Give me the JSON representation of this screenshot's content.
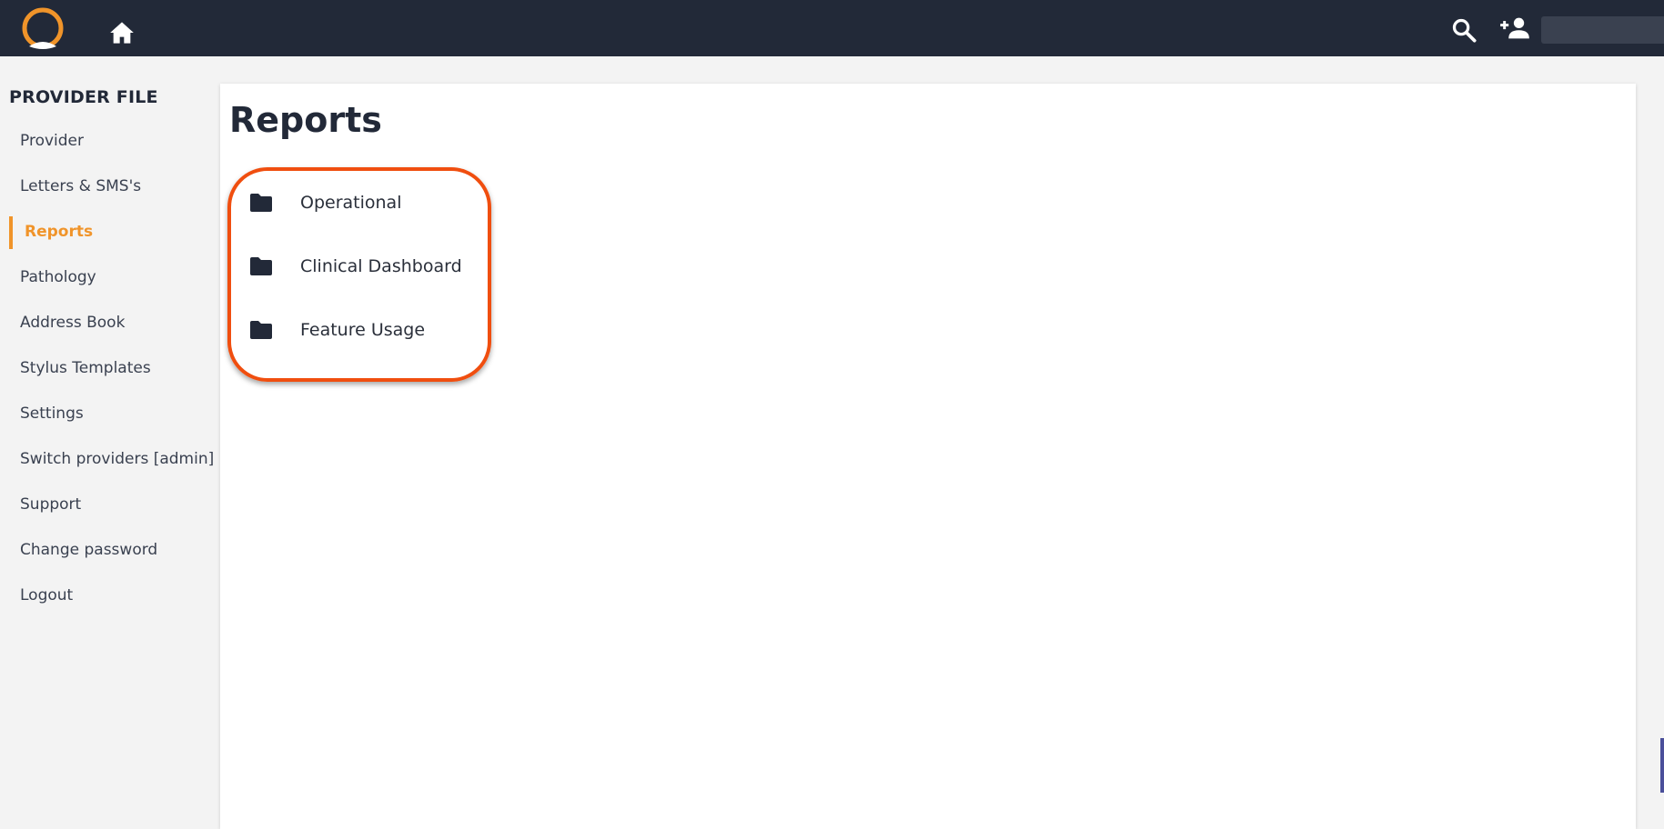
{
  "topbar": {
    "colors": {
      "background": "#222938",
      "accent": "#f0942a"
    },
    "icons": [
      "app-logo-icon",
      "home-icon",
      "search-icon",
      "add-person-icon"
    ]
  },
  "sidebar": {
    "title": "PROVIDER FILE",
    "items": [
      {
        "label": "Provider",
        "active": false
      },
      {
        "label": "Letters & SMS's",
        "active": false
      },
      {
        "label": "Reports",
        "active": true
      },
      {
        "label": "Pathology",
        "active": false
      },
      {
        "label": "Address Book",
        "active": false
      },
      {
        "label": "Stylus Templates",
        "active": false
      },
      {
        "label": "Settings",
        "active": false
      },
      {
        "label": "Switch providers [admin]",
        "active": false
      },
      {
        "label": "Support",
        "active": false
      },
      {
        "label": "Change password",
        "active": false
      },
      {
        "label": "Logout",
        "active": false
      }
    ]
  },
  "main": {
    "title": "Reports",
    "reports": [
      {
        "label": "Operational",
        "icon": "folder-icon"
      },
      {
        "label": "Clinical Dashboard",
        "icon": "folder-icon"
      },
      {
        "label": "Feature Usage",
        "icon": "folder-icon"
      }
    ],
    "highlight_color": "#f04e0f"
  }
}
